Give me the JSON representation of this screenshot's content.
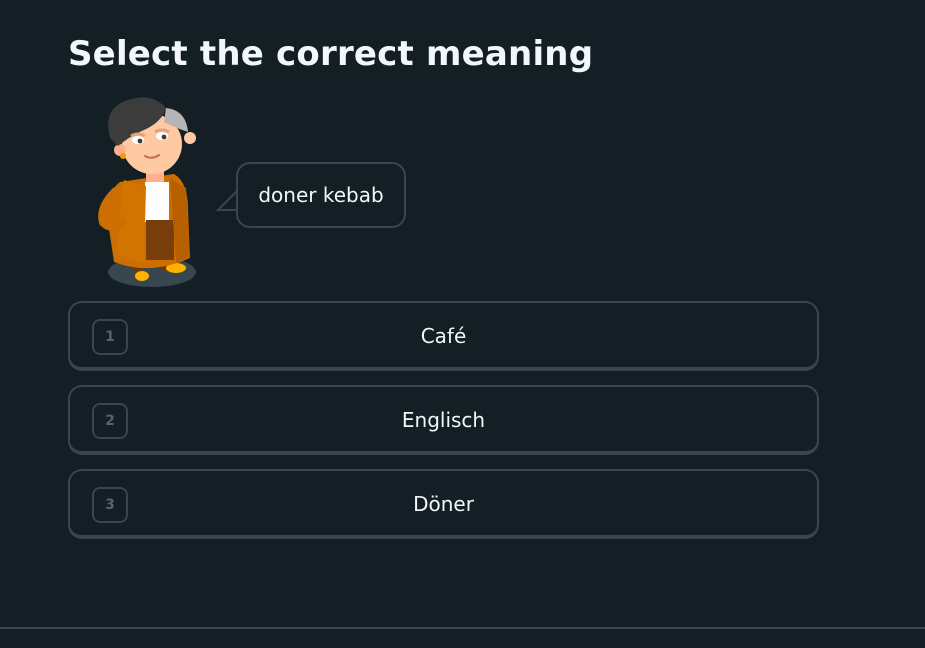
{
  "challenge": {
    "title": "Select the correct meaning",
    "prompt_text": "doner kebab",
    "options": [
      {
        "number": "1",
        "label": "Café"
      },
      {
        "number": "2",
        "label": "Englisch"
      },
      {
        "number": "3",
        "label": "Döner"
      }
    ]
  },
  "colors": {
    "background": "#131f24",
    "border": "#37464f",
    "text": "#f1f7fb",
    "number_text": "#52656d",
    "character_coat": "#cd6f00"
  }
}
